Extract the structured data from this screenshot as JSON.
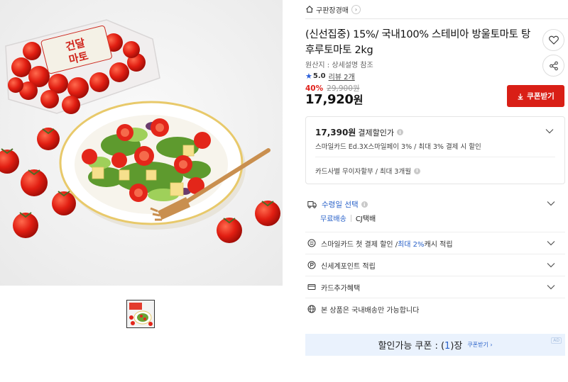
{
  "product_image": {
    "label_line1": "건달",
    "label_line2": "마토"
  },
  "breadcrumb": {
    "label": "구판장경매"
  },
  "product": {
    "title": "(신선집중) 15%/ 국내100% 스테비아 방울토마토 탕후루토마토 2kg",
    "origin": "원산지 : 상세설명 참조",
    "rating": "5.0",
    "review": "리뷰 2개",
    "discount_rate": "40%",
    "original_price": "29,900원",
    "price": "17,920",
    "price_unit": "원",
    "coupon_button": "쿠폰받기"
  },
  "payment": {
    "amount": "17,390원",
    "label": "결제할인가",
    "detail": "스마일카드 Ed.3X스마일페이 3% / 최대 3% 결제 시 할인",
    "installment": "카드사별 무이자할부 / 최대 3개월"
  },
  "shipping": {
    "label": "수령일 선택",
    "free": "무료배송",
    "carrier": "CJ택배"
  },
  "benefits": [
    {
      "pre": "스마일카드 첫 결제 할인 / ",
      "highlight": "최대 2%",
      "post": " 캐시 적립"
    },
    {
      "pre": "신세계포인트 적립",
      "highlight": "",
      "post": ""
    },
    {
      "pre": "카드추가혜택",
      "highlight": "",
      "post": ""
    },
    {
      "pre": "본 상품은 국내배송만 가능합니다",
      "highlight": "",
      "post": ""
    }
  ],
  "coupon_banner": {
    "prefix": "할인가능 쿠폰 : (",
    "count": "1",
    "suffix": ")장",
    "link": "쿠폰받기 ›",
    "ad": "AD"
  },
  "colors": {
    "accent_red": "#d91f16",
    "accent_blue": "#2a62c9",
    "banner_bg": "#eaf2fd"
  }
}
